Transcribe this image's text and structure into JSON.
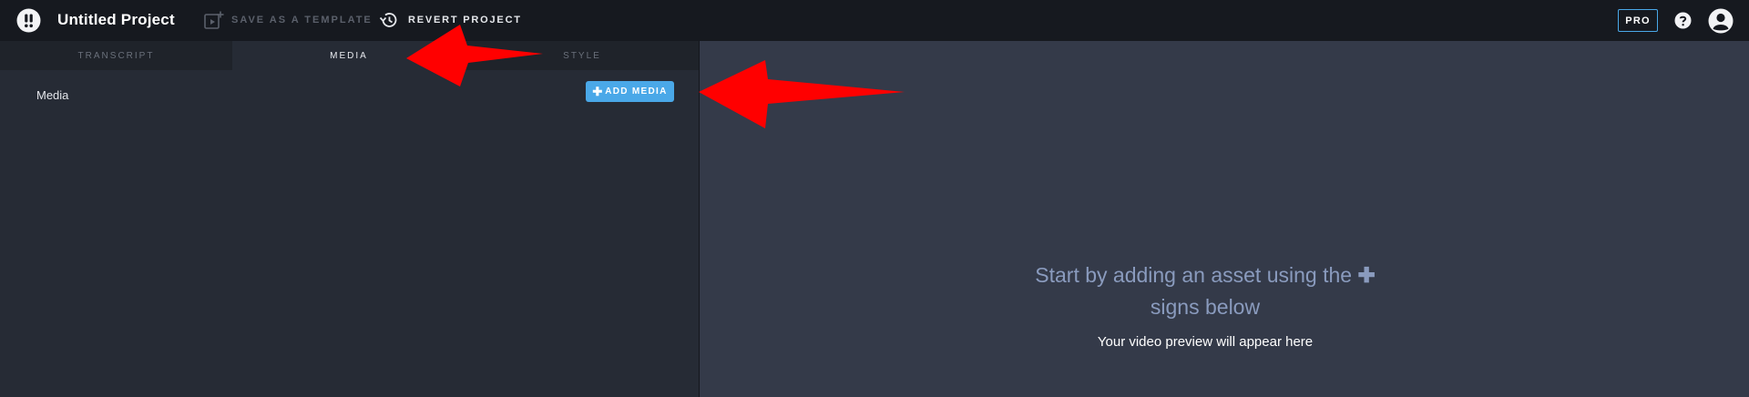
{
  "topbar": {
    "project_title": "Untitled Project",
    "save_template_label": "SAVE AS A TEMPLATE",
    "revert_label": "REVERT PROJECT",
    "pro_label": "PRO"
  },
  "tabs": [
    {
      "label": "TRANSCRIPT",
      "active": false
    },
    {
      "label": "MEDIA",
      "active": true
    },
    {
      "label": "STYLE",
      "active": false
    }
  ],
  "media_panel": {
    "section_label": "Media",
    "add_media_label": "ADD MEDIA"
  },
  "preview": {
    "heading_line1": "Start by adding an asset using the",
    "plus_glyph": "✚",
    "heading_line2": "signs below",
    "subtext": "Your video preview will appear here"
  },
  "icons": {
    "logo": "logo-icon",
    "save_template": "add-frame-icon",
    "revert": "history-icon",
    "help": "help-icon",
    "account": "account-icon",
    "add": "plus-icon"
  },
  "colors": {
    "accent": "#4aa8e8",
    "topbar": "#16191f",
    "left_panel": "#262b35",
    "preview_panel": "#343a49",
    "heading_text": "#8a9bbe",
    "annotation_arrow": "#ff0000"
  }
}
